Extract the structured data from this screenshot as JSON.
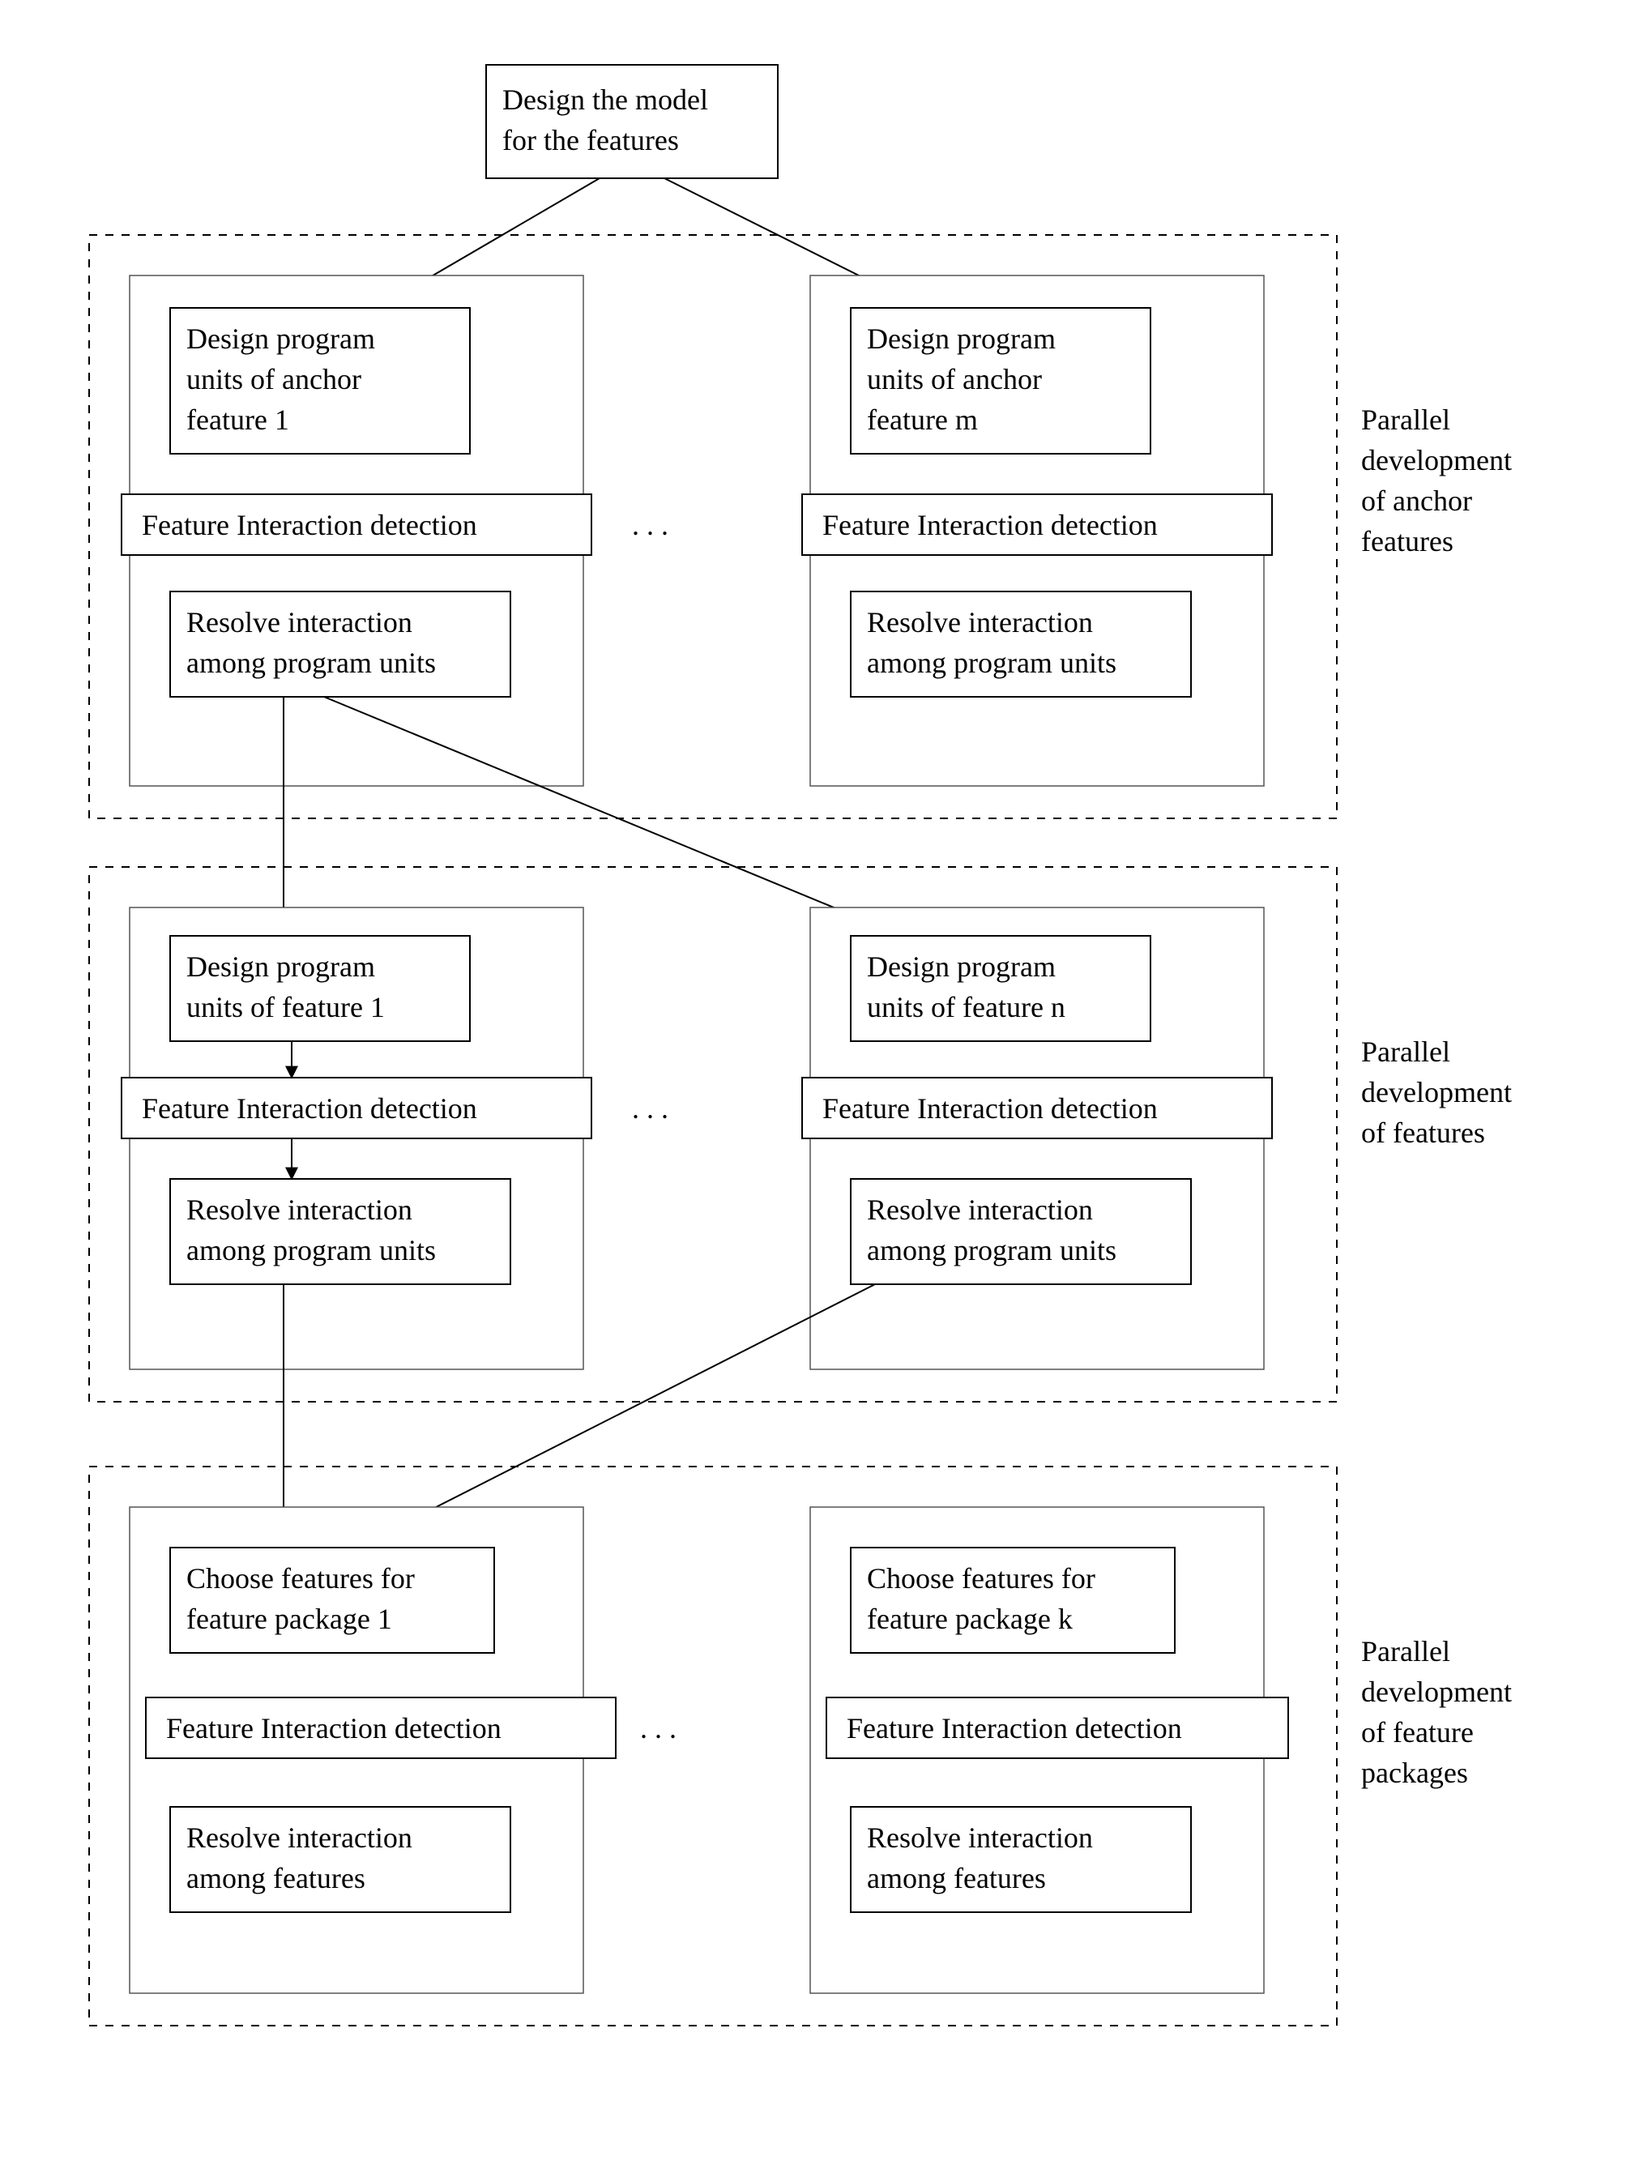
{
  "top": {
    "line1": "Design the model",
    "line2": "for the features"
  },
  "sections": {
    "anchor": {
      "label1": "Parallel",
      "label2": "development",
      "label3": "of anchor",
      "label4": "features",
      "left": {
        "design1": "Design program",
        "design2": "units of  anchor",
        "design3": "feature 1",
        "fid": "Feature Interaction detection",
        "resolve1": "Resolve interaction",
        "resolve2": "among program units"
      },
      "right": {
        "design1": "Design program",
        "design2": "units of  anchor",
        "design3": "feature m",
        "fid": "Feature Interaction detection",
        "resolve1": "Resolve interaction",
        "resolve2": "among program units"
      }
    },
    "features": {
      "label1": "Parallel",
      "label2": "development",
      "label3": "of features",
      "left": {
        "design1": "Design program",
        "design2": "units of feature 1",
        "fid": "Feature Interaction detection",
        "resolve1": "Resolve interaction",
        "resolve2": "among program units"
      },
      "right": {
        "design1": "Design program",
        "design2": "units of feature n",
        "fid": "Feature Interaction detection",
        "resolve1": "Resolve interaction",
        "resolve2": "among program units"
      }
    },
    "packages": {
      "label1": "Parallel",
      "label2": "development",
      "label3": "of feature",
      "label4": "packages",
      "left": {
        "choose1": "Choose features for",
        "choose2": "feature package 1",
        "fid": "Feature Interaction detection",
        "resolve1": "Resolve interaction",
        "resolve2": "among features"
      },
      "right": {
        "choose1": "Choose features for",
        "choose2": "feature package k",
        "fid": "Feature Interaction detection",
        "resolve1": "Resolve interaction",
        "resolve2": "among features"
      }
    }
  },
  "dots": ".   .   ."
}
